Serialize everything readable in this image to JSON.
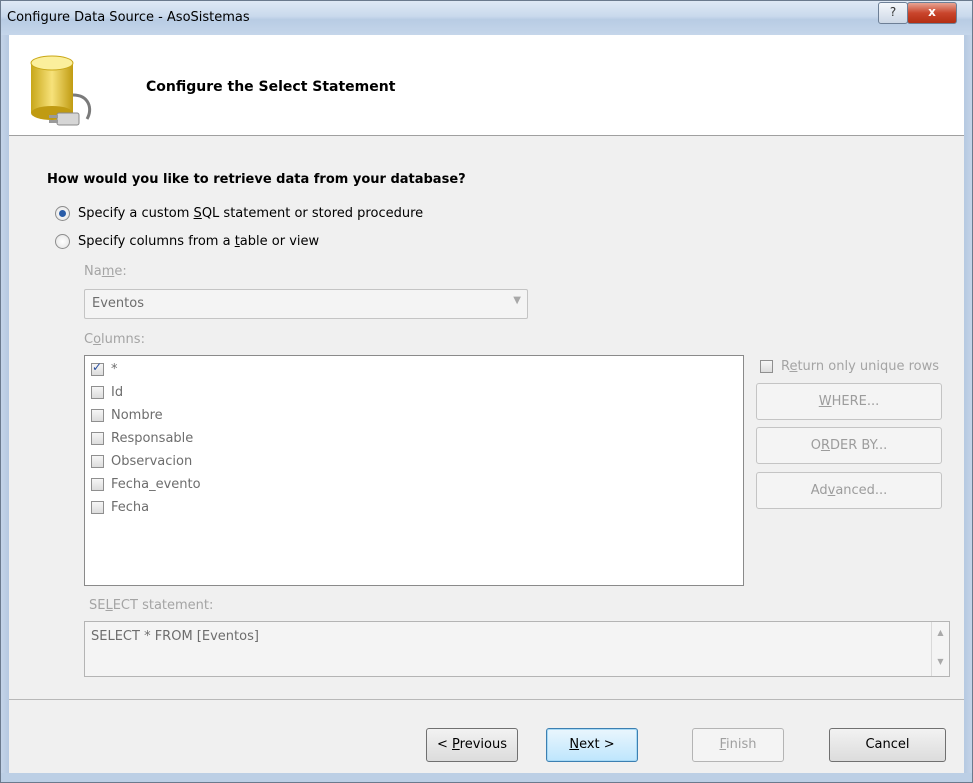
{
  "window": {
    "title": "Configure Data Source - AsoSistemas",
    "help_label": "?",
    "close_label": "x"
  },
  "header": {
    "title": "Configure the Select Statement"
  },
  "question": "How would you like to retrieve data from your database?",
  "options": {
    "custom_sql": {
      "pre": "Specify a custom ",
      "ul": "S",
      "post": "QL statement or stored procedure",
      "selected": true
    },
    "table_view": {
      "pre": "Specify columns from a ",
      "ul": "t",
      "post": "able or view",
      "selected": false
    }
  },
  "name_field": {
    "label_pre": "Na",
    "label_ul": "m",
    "label_post": "e:",
    "value": "Eventos"
  },
  "columns": {
    "label_pre": "C",
    "label_ul": "o",
    "label_post": "lumns:",
    "items": [
      {
        "label": "*",
        "checked": true
      },
      {
        "label": "Id",
        "checked": false
      },
      {
        "label": "Nombre",
        "checked": false
      },
      {
        "label": "Responsable",
        "checked": false
      },
      {
        "label": "Observacion",
        "checked": false
      },
      {
        "label": "Fecha_evento",
        "checked": false
      },
      {
        "label": "Fecha",
        "checked": false
      }
    ]
  },
  "unique_rows": {
    "pre": "R",
    "ul": "e",
    "post": "turn only unique rows",
    "checked": false
  },
  "side_buttons": {
    "where": {
      "ul": "W",
      "post": "HERE..."
    },
    "order_by": {
      "pre": "O",
      "ul": "R",
      "post": "DER BY..."
    },
    "advanced": {
      "pre": "Ad",
      "ul": "v",
      "post": "anced..."
    }
  },
  "select_statement": {
    "label_pre": "SE",
    "label_ul": "L",
    "label_post": "ECT statement:",
    "value": "SELECT * FROM [Eventos]"
  },
  "footer": {
    "previous": {
      "pre": "< ",
      "ul": "P",
      "post": "revious"
    },
    "next": {
      "ul": "N",
      "post": "ext >"
    },
    "finish": {
      "ul": "F",
      "post": "inish"
    },
    "cancel": "Cancel"
  }
}
